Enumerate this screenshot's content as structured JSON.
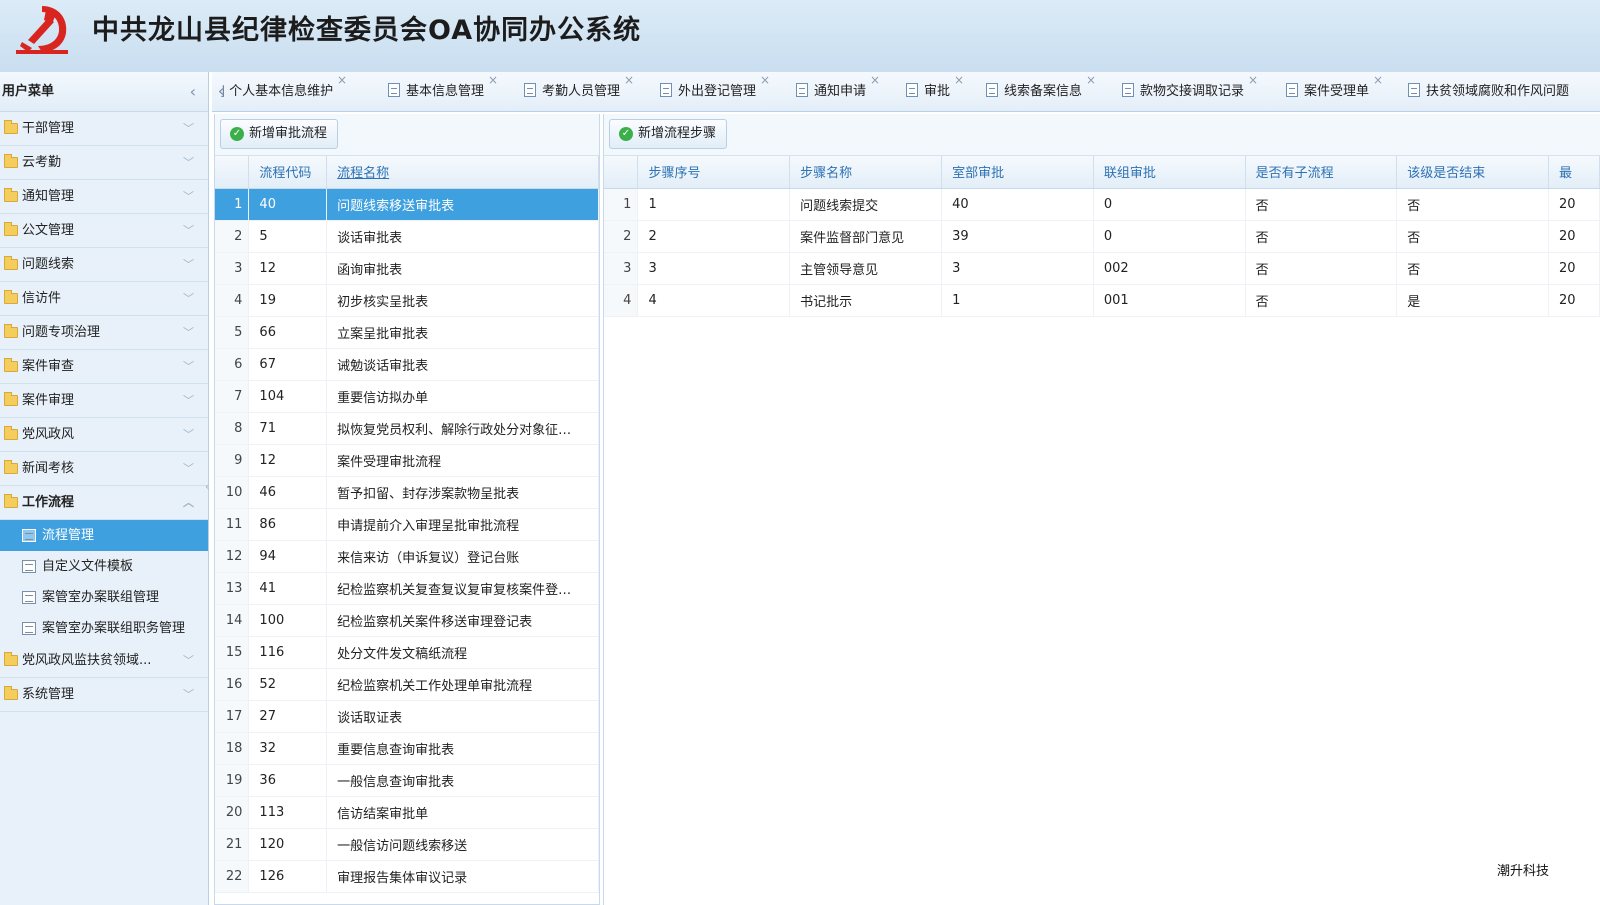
{
  "header": {
    "title": "中共龙山县纪律检查委员会OA协同办公系统"
  },
  "sidebar": {
    "title": "用户菜单",
    "items": [
      {
        "label": "干部管理"
      },
      {
        "label": "云考勤"
      },
      {
        "label": "通知管理"
      },
      {
        "label": "公文管理"
      },
      {
        "label": "问题线索"
      },
      {
        "label": "信访件"
      },
      {
        "label": "问题专项治理"
      },
      {
        "label": "案件审查"
      },
      {
        "label": "案件审理"
      },
      {
        "label": "党风政风"
      },
      {
        "label": "新闻考核"
      },
      {
        "label": "工作流程"
      }
    ],
    "sub_items": [
      {
        "label": "流程管理"
      },
      {
        "label": "自定义文件模板"
      },
      {
        "label": "案管室办案联组管理"
      },
      {
        "label": "案管室办案联组职务管理"
      }
    ],
    "bottom_items": [
      {
        "label": "党风政风监扶贫领域..."
      },
      {
        "label": "系统管理"
      }
    ]
  },
  "tabs": [
    {
      "label": "个人基本信息维护"
    },
    {
      "label": "基本信息管理"
    },
    {
      "label": "考勤人员管理"
    },
    {
      "label": "外出登记管理"
    },
    {
      "label": "通知申请"
    },
    {
      "label": "审批"
    },
    {
      "label": "线索备案信息"
    },
    {
      "label": "款物交接调取记录"
    },
    {
      "label": "案件受理单"
    },
    {
      "label": "扶贫领域腐败和作风问题"
    }
  ],
  "left": {
    "button": "新增审批流程",
    "columns": [
      "流程代码",
      "流程名称"
    ],
    "rows": [
      {
        "n": "1",
        "code": "40",
        "name": "问题线索移送审批表"
      },
      {
        "n": "2",
        "code": "5",
        "name": "谈话审批表"
      },
      {
        "n": "3",
        "code": "12",
        "name": "函询审批表"
      },
      {
        "n": "4",
        "code": "19",
        "name": "初步核实呈批表"
      },
      {
        "n": "5",
        "code": "66",
        "name": "立案呈批审批表"
      },
      {
        "n": "6",
        "code": "67",
        "name": "诫勉谈话审批表"
      },
      {
        "n": "7",
        "code": "104",
        "name": "重要信访拟办单"
      },
      {
        "n": "8",
        "code": "71",
        "name": "拟恢复党员权利、解除行政处分对象征…"
      },
      {
        "n": "9",
        "code": "12",
        "name": "案件受理审批流程"
      },
      {
        "n": "10",
        "code": "46",
        "name": "暂予扣留、封存涉案款物呈批表"
      },
      {
        "n": "11",
        "code": "86",
        "name": "申请提前介入审理呈批审批流程"
      },
      {
        "n": "12",
        "code": "94",
        "name": "来信来访（申诉复议）登记台账"
      },
      {
        "n": "13",
        "code": "41",
        "name": "纪检监察机关复查复议复审复核案件登…"
      },
      {
        "n": "14",
        "code": "100",
        "name": "纪检监察机关案件移送审理登记表"
      },
      {
        "n": "15",
        "code": "116",
        "name": "处分文件发文稿纸流程"
      },
      {
        "n": "16",
        "code": "52",
        "name": "纪检监察机关工作处理单审批流程"
      },
      {
        "n": "17",
        "code": "27",
        "name": "谈话取证表"
      },
      {
        "n": "18",
        "code": "32",
        "name": "重要信息查询审批表"
      },
      {
        "n": "19",
        "code": "36",
        "name": "一般信息查询审批表"
      },
      {
        "n": "20",
        "code": "113",
        "name": "信访结案审批单"
      },
      {
        "n": "21",
        "code": "120",
        "name": "一般信访问题线索移送"
      },
      {
        "n": "22",
        "code": "126",
        "name": "审理报告集体审议记录"
      }
    ]
  },
  "right": {
    "button": "新增流程步骤",
    "columns": [
      "步骤序号",
      "步骤名称",
      "室部审批",
      "联组审批",
      "是否有子流程",
      "该级是否结束",
      "最"
    ],
    "rows": [
      {
        "n": "1",
        "seq": "1",
        "name": "问题线索提交",
        "dept": "40",
        "group": "0",
        "sub": "否",
        "end": "否",
        "last": "20"
      },
      {
        "n": "2",
        "seq": "2",
        "name": "案件监督部门意见",
        "dept": "39",
        "group": "0",
        "sub": "否",
        "end": "否",
        "last": "20"
      },
      {
        "n": "3",
        "seq": "3",
        "name": "主管领导意见",
        "dept": "3",
        "group": "002",
        "sub": "否",
        "end": "否",
        "last": "20"
      },
      {
        "n": "4",
        "seq": "4",
        "name": "书记批示",
        "dept": "1",
        "group": "001",
        "sub": "否",
        "end": "是",
        "last": "20"
      }
    ]
  },
  "watermark": "潮升科技"
}
